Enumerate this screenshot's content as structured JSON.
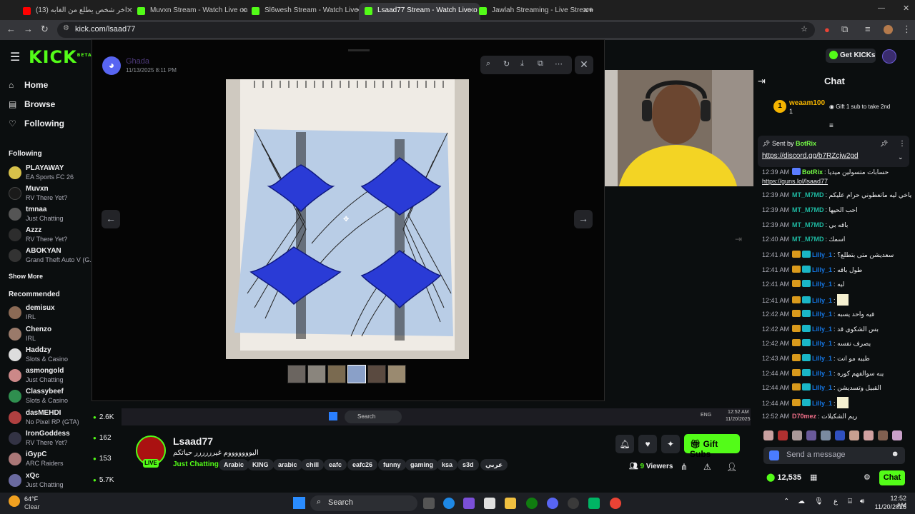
{
  "browser": {
    "tabs": [
      {
        "label": "(13) اخر شخص يطلع من الغابه",
        "active": false,
        "favicon": "youtube"
      },
      {
        "label": "Muvxn Stream - Watch Live on",
        "active": false,
        "favicon": "kick"
      },
      {
        "label": "Sl6wesh Stream - Watch Live on",
        "active": false,
        "favicon": "kick"
      },
      {
        "label": "Lsaad77 Stream - Watch Live o",
        "active": true,
        "favicon": "kick"
      },
      {
        "label": "Jawlah Streaming - Live Stream",
        "active": false,
        "favicon": "kick"
      }
    ],
    "url": "kick.com/lsaad77"
  },
  "header": {
    "logo": "KICK",
    "logo_sup": "BETA",
    "get_kicks": "Get KICKs"
  },
  "sidebar": {
    "nav": [
      {
        "label": "Home",
        "icon": "home-icon"
      },
      {
        "label": "Browse",
        "icon": "browse-icon"
      },
      {
        "label": "Following",
        "icon": "heart-icon"
      }
    ],
    "following_title": "Following",
    "following": [
      {
        "name": "PLAYAWAY",
        "category": "EA Sports FC 26",
        "viewers": ""
      },
      {
        "name": "Muvxn",
        "category": "RV There Yet?",
        "viewers": ""
      },
      {
        "name": "tmnaa",
        "category": "Just Chatting",
        "viewers": ""
      },
      {
        "name": "Azzz",
        "category": "RV There Yet?",
        "viewers": ""
      },
      {
        "name": "ABOKYAN",
        "category": "Grand Theft Auto V (G...",
        "viewers": ""
      }
    ],
    "show_more": "Show More",
    "recommended_title": "Recommended",
    "recommended": [
      {
        "name": "demisux",
        "category": "IRL",
        "viewers": ""
      },
      {
        "name": "Chenzo",
        "category": "IRL",
        "viewers": ""
      },
      {
        "name": "Haddzy",
        "category": "Slots & Casino",
        "viewers": ""
      },
      {
        "name": "asmongold",
        "category": "Just Chatting",
        "viewers": ""
      },
      {
        "name": "Classybeef",
        "category": "Slots & Casino",
        "viewers": ""
      },
      {
        "name": "dasMEHDI",
        "category": "No Pixel RP (GTA)",
        "viewers": "2.6K"
      },
      {
        "name": "IronGoddess",
        "category": "RV There Yet?",
        "viewers": "162"
      },
      {
        "name": "iGypC",
        "category": "ARC Raiders",
        "viewers": "153"
      },
      {
        "name": "xQc",
        "category": "Just Chatting",
        "viewers": "5.7K"
      }
    ]
  },
  "modal": {
    "author": "Ghada",
    "timestamp": "11/13/2025 8:11 PM",
    "thumbnail_count": 6
  },
  "stream": {
    "streamer": "Lsaad77",
    "title": "اليوووووووم غيرررررر حياتكم",
    "category": "Just Chatting",
    "tags": [
      "Arabic",
      "KING",
      "arabic",
      "chill",
      "eafc",
      "eafc26",
      "funny",
      "gaming",
      "ksa",
      "s3d",
      "عربي"
    ],
    "viewers": "9",
    "viewers_label": "Viewers",
    "live_label": "LIVE",
    "gift_subs": "Gift Subs"
  },
  "chat": {
    "title": "Chat",
    "top_gifter": {
      "name": "weaam100",
      "count": "1",
      "hint": "Gift 1 sub to take 2nd"
    },
    "pinned": {
      "sent_by": "Sent by",
      "user": "BotRix",
      "link": "https://discord.gg/b7RZcjw2gd"
    },
    "messages": [
      {
        "time": "12:39 AM",
        "user": "BotRix",
        "text": "حسابات متسولين ميديا",
        "color": "#75fd46",
        "type": "bot"
      },
      {
        "time": "",
        "user": "",
        "text": "https://guns.lol/lsaad77",
        "color": "#efeff1",
        "type": "link"
      },
      {
        "time": "12:39 AM",
        "user": "MT_M7MD",
        "text": "ياخي ليه ماتعطوني حرام عليكم",
        "color": "#1eb8a1",
        "type": "user"
      },
      {
        "time": "12:39 AM",
        "user": "MT_M7MD",
        "text": "احب الحيها",
        "color": "#1eb8a1",
        "type": "user"
      },
      {
        "time": "12:39 AM",
        "user": "MT_M7MD",
        "text": "باقه بي",
        "color": "#1eb8a1",
        "type": "user"
      },
      {
        "time": "12:40 AM",
        "user": "MT_M7MD",
        "text": "اسمك",
        "color": "#1eb8a1",
        "type": "user"
      },
      {
        "time": "12:41 AM",
        "user": "Lilly_1",
        "text": "سعديشن متى بتطلع؟",
        "color": "#1475e1",
        "type": "sub"
      },
      {
        "time": "12:41 AM",
        "user": "Lilly_1",
        "text": "طول باقه",
        "color": "#1475e1",
        "type": "sub"
      },
      {
        "time": "12:41 AM",
        "user": "Lilly_1",
        "text": "ليه",
        "color": "#1475e1",
        "type": "sub"
      },
      {
        "time": "12:41 AM",
        "user": "Lilly_1",
        "text": "",
        "color": "#1475e1",
        "type": "sub-emote"
      },
      {
        "time": "12:42 AM",
        "user": "Lilly_1",
        "text": "فيه واحد يسبه",
        "color": "#1475e1",
        "type": "sub"
      },
      {
        "time": "12:42 AM",
        "user": "Lilly_1",
        "text": "بس الشكوى قد",
        "color": "#1475e1",
        "type": "sub"
      },
      {
        "time": "12:42 AM",
        "user": "Lilly_1",
        "text": "يصرف نفسه",
        "color": "#1475e1",
        "type": "sub"
      },
      {
        "time": "12:43 AM",
        "user": "Lilly_1",
        "text": "طيبه مو انت",
        "color": "#1475e1",
        "type": "sub"
      },
      {
        "time": "12:44 AM",
        "user": "Lilly_1",
        "text": "يبه سوالفهم كوره",
        "color": "#1475e1",
        "type": "sub"
      },
      {
        "time": "12:44 AM",
        "user": "Lilly_1",
        "text": "القبيل وتسديشن",
        "color": "#1475e1",
        "type": "sub"
      },
      {
        "time": "12:44 AM",
        "user": "Lilly_1",
        "text": "",
        "color": "#1475e1",
        "type": "sub-emote"
      },
      {
        "time": "12:52 AM",
        "user": "D70mez",
        "text": "ريم الشكيلات",
        "color": "#f2708a",
        "type": "user"
      }
    ],
    "input_placeholder": "Send a message",
    "points": "12,535",
    "chat_button": "Chat"
  },
  "inner_taskbar": {
    "search": "Search",
    "time": "12:52 AM",
    "date": "11/20/2025",
    "lang": "ENG"
  },
  "taskbar": {
    "weather_temp": "64°F",
    "weather_desc": "Clear",
    "search": "Search",
    "time": "12:52 AM",
    "date": "11/20/2025",
    "lang": "ع"
  },
  "colors": {
    "brand": "#53fc18",
    "bg": "#0b0e0f",
    "card": "#24272c"
  }
}
